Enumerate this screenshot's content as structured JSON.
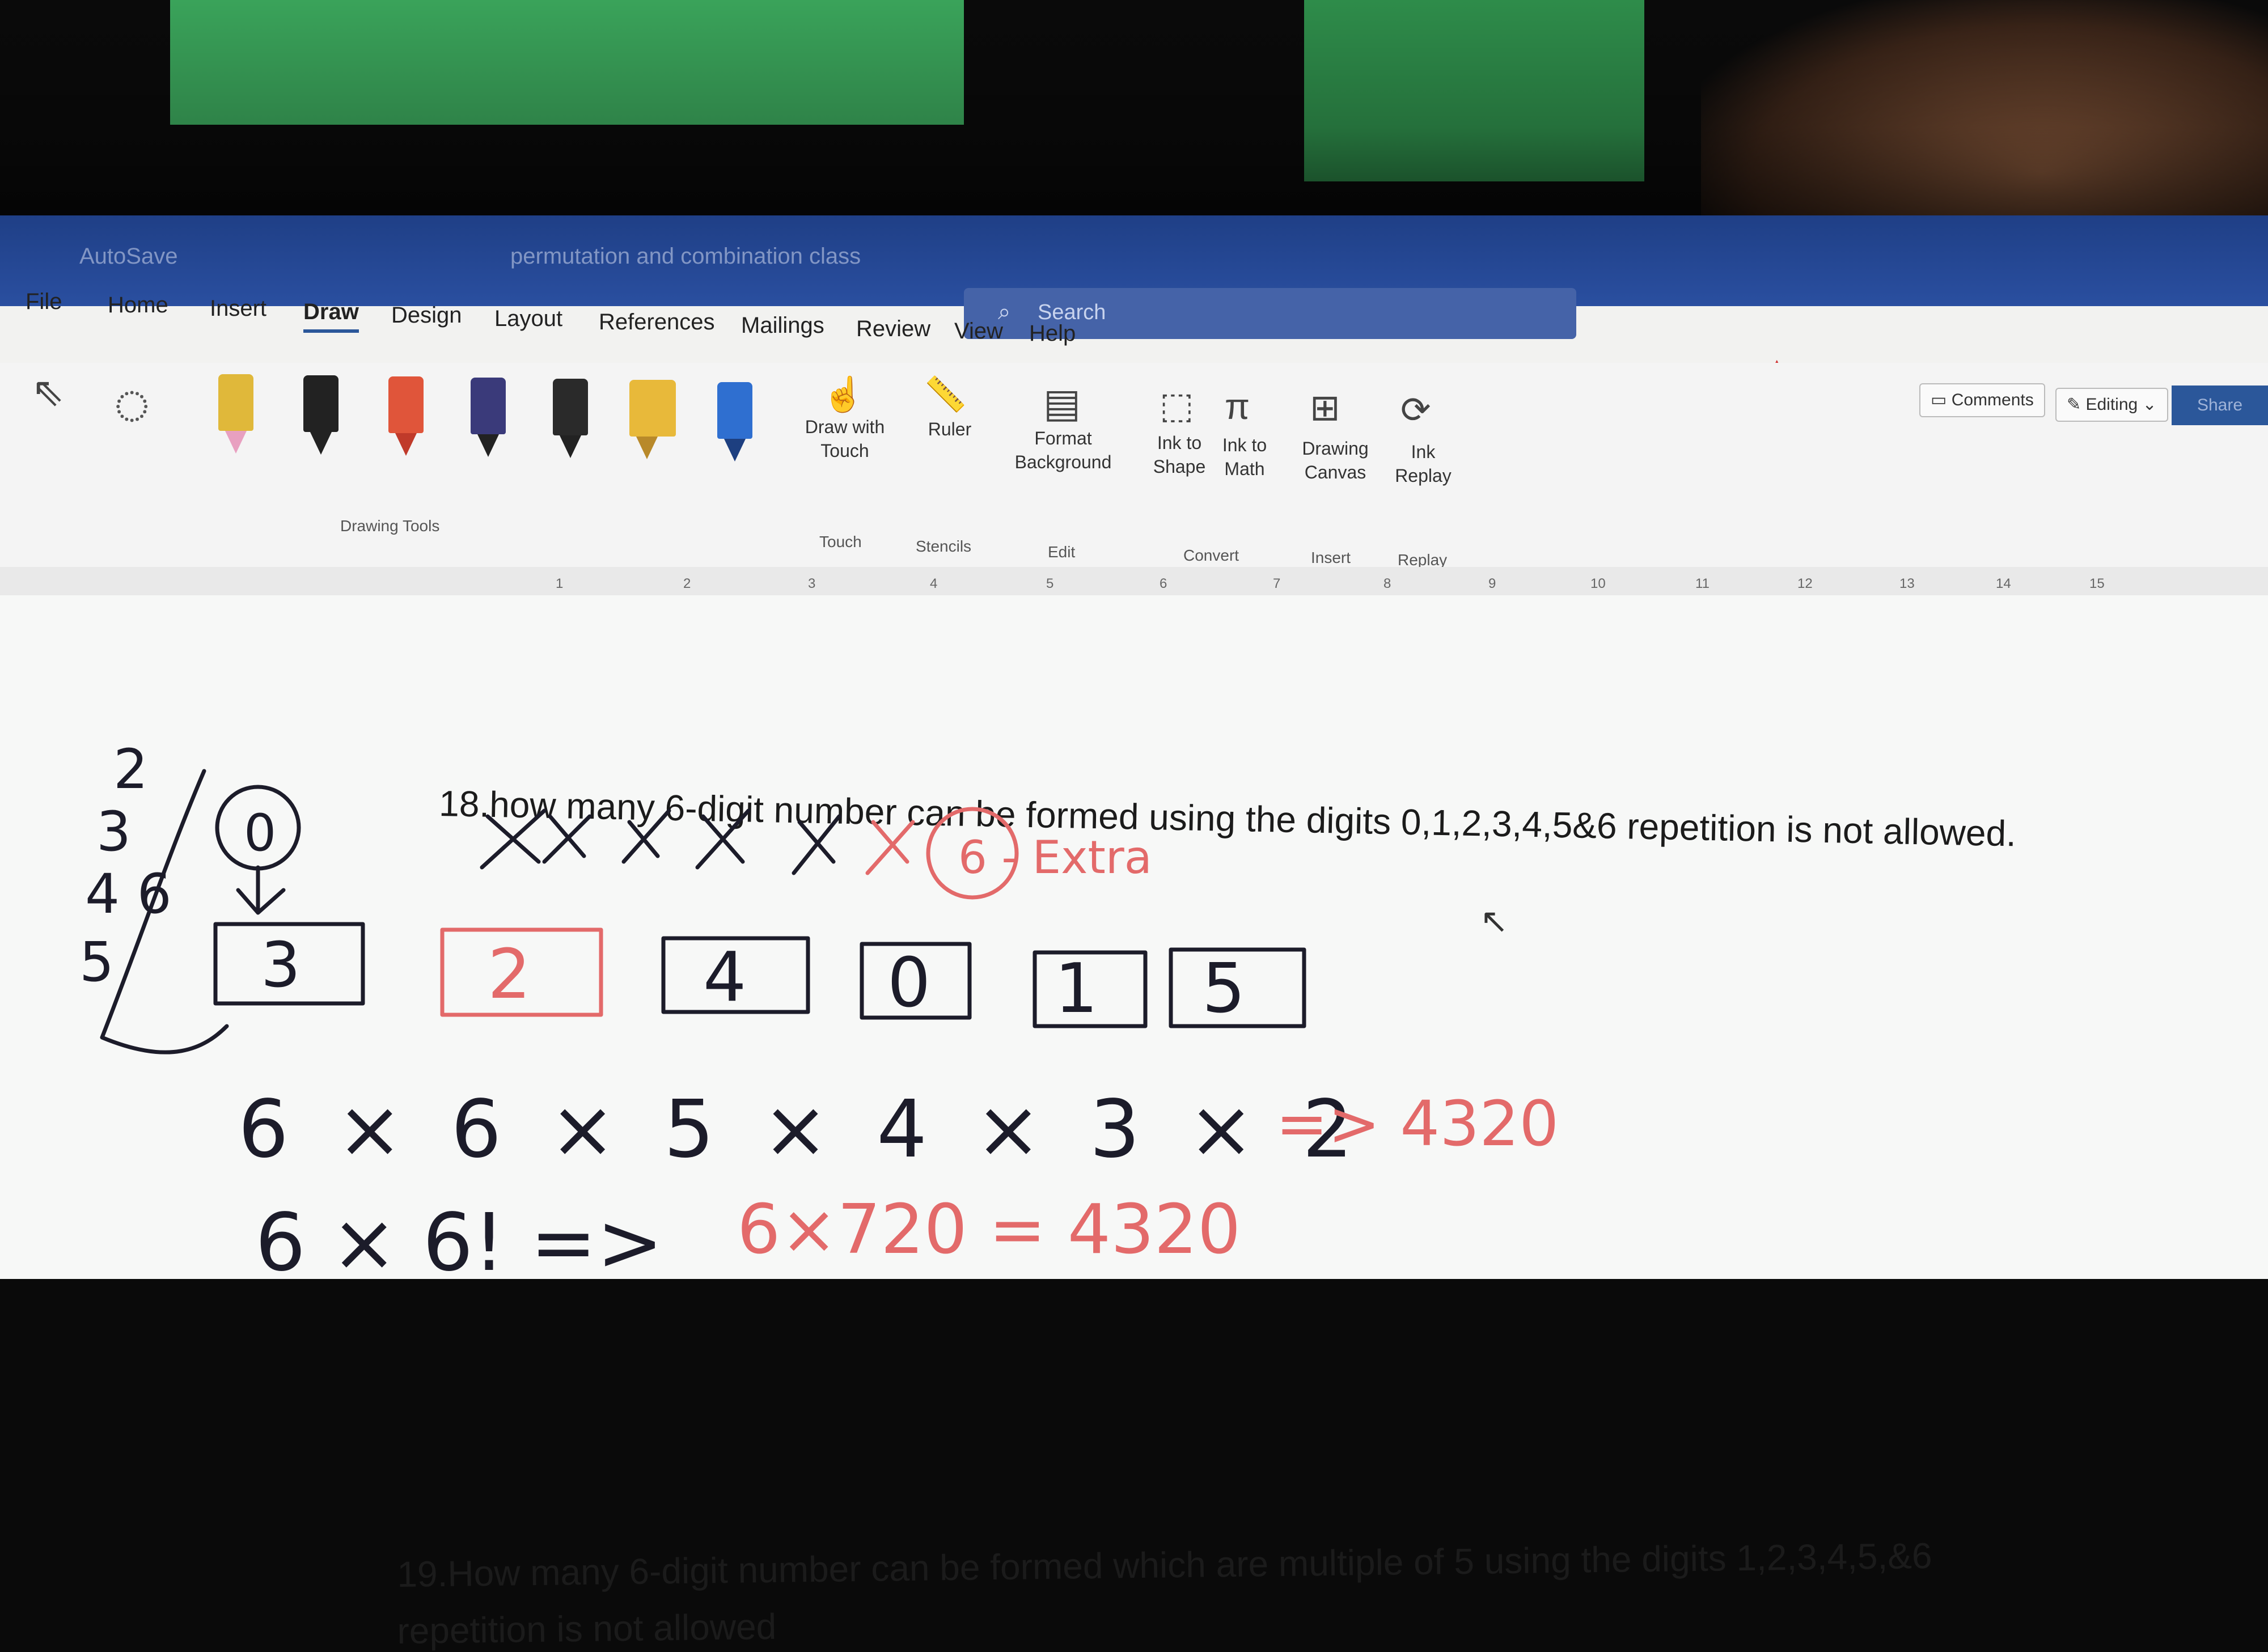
{
  "titlebar": {
    "autosave_label": "AutoSave",
    "doc_title": "permutation and combination class"
  },
  "search": {
    "placeholder": "Search"
  },
  "tabs": [
    "File",
    "Home",
    "Insert",
    "Draw",
    "Design",
    "Layout",
    "References",
    "Mailings",
    "Review",
    "View",
    "Help"
  ],
  "active_tab": "Draw",
  "ribbon": {
    "draw_with_touch": "Draw with Touch",
    "ruler": "Ruler",
    "format_background": "Format Background",
    "ink_to_shape": "Ink to Shape",
    "ink_to_math": "Ink to Math",
    "drawing_canvas": "Drawing Canvas",
    "ink_replay": "Ink Replay",
    "groups": {
      "drawing_tools": "Drawing Tools",
      "touch": "Touch",
      "stencils": "Stencils",
      "edit": "Edit",
      "convert": "Convert",
      "insert": "Insert",
      "replay": "Replay"
    },
    "comments": "Comments",
    "editing": "Editing",
    "share": "Share",
    "pen_colors": [
      "#e0b83a",
      "#222222",
      "#e0553a",
      "#3a3a7a",
      "#2a2a2a",
      "#e8b93a",
      "#2f6fd0"
    ]
  },
  "ruler_numbers": [
    "1",
    "2",
    "3",
    "4",
    "5",
    "6",
    "7",
    "8",
    "9",
    "10",
    "11",
    "12",
    "13",
    "14",
    "15"
  ],
  "document": {
    "q18": "18.how many 6-digit number can be formed using the digits 0,1,2,3,4,5&6 repetition is not allowed.",
    "q19_line1": "19.How many 6-digit number can be formed which are multiple of 5 using the digits 1,2,3,4,5,&6",
    "q19_line2": "repetition is not allowed"
  },
  "handwriting": {
    "extra_note": "6 - Extra",
    "boxes": [
      "2",
      "4",
      "0",
      "1",
      "5"
    ],
    "side_box": "3",
    "side_circle": "0",
    "side_list": [
      "2",
      "3",
      "4 6",
      "5"
    ],
    "line1_black": "6 × 6 × 5 × 4 × 3 × 2",
    "line1_red": "=> 4320",
    "line2_black": "6 × 6! =>",
    "line2_red": "6×720 = 4320"
  }
}
